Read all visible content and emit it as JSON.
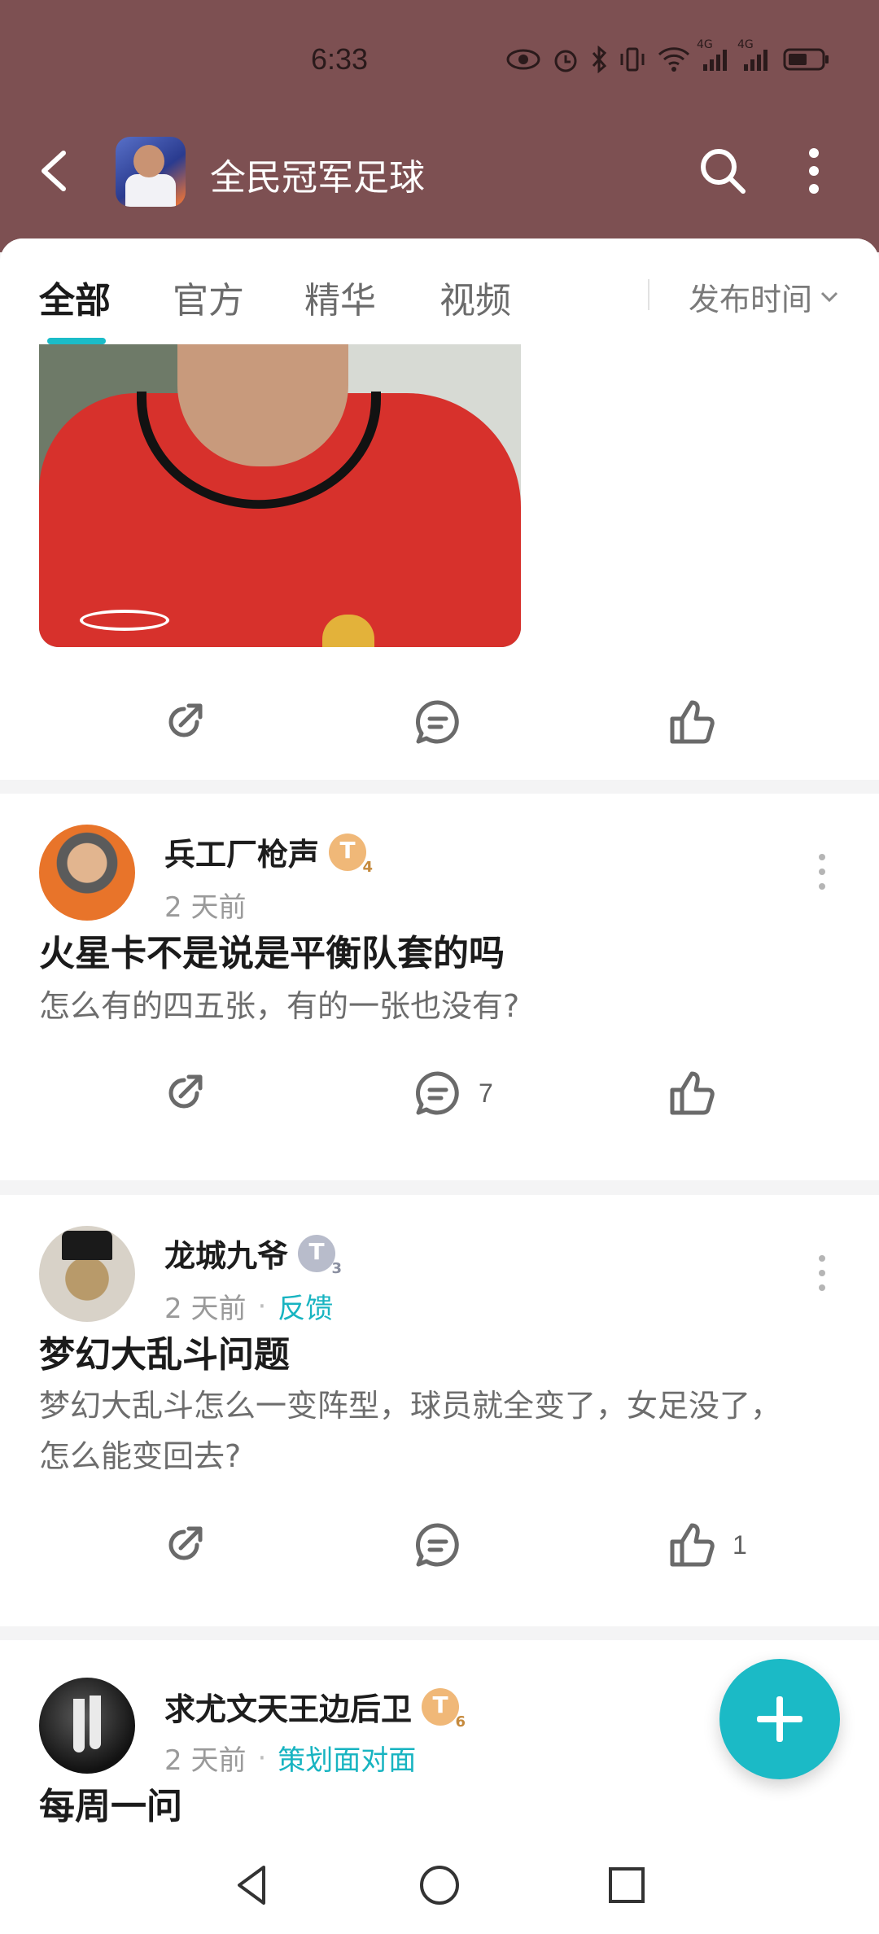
{
  "status_bar": {
    "time": "6:33",
    "network_labels": [
      "4G",
      "4G"
    ]
  },
  "header": {
    "title": "全民冠军足球"
  },
  "tabs": [
    {
      "label": "全部",
      "active": true
    },
    {
      "label": "官方",
      "active": false
    },
    {
      "label": "精华",
      "active": false
    },
    {
      "label": "视频",
      "active": false
    }
  ],
  "sort": {
    "label": "发布时间"
  },
  "posts": [
    {
      "actions": {
        "comment_count": "",
        "like_count": ""
      }
    },
    {
      "author": "兵工厂枪声",
      "badge": "T",
      "badge_level": "4",
      "time": "2 天前",
      "title": "火星卡不是说是平衡队套的吗",
      "body": "怎么有的四五张，有的一张也没有?",
      "actions": {
        "comment_count": "7",
        "like_count": ""
      }
    },
    {
      "author": "龙城九爷",
      "badge": "T",
      "badge_level": "3",
      "time": "2 天前",
      "tag": "反馈",
      "title": "梦幻大乱斗问题",
      "body": "梦幻大乱斗怎么一变阵型，球员就全变了，女足没了，怎么能变回去?",
      "actions": {
        "comment_count": "",
        "like_count": "1"
      }
    },
    {
      "author": "求尤文天王边后卫",
      "badge": "T",
      "badge_level": "6",
      "time": "2 天前",
      "tag": "策划面对面",
      "title": "每周一问"
    }
  ],
  "colors": {
    "accent": "#1bbac6",
    "header_bg": "#7d5052"
  }
}
